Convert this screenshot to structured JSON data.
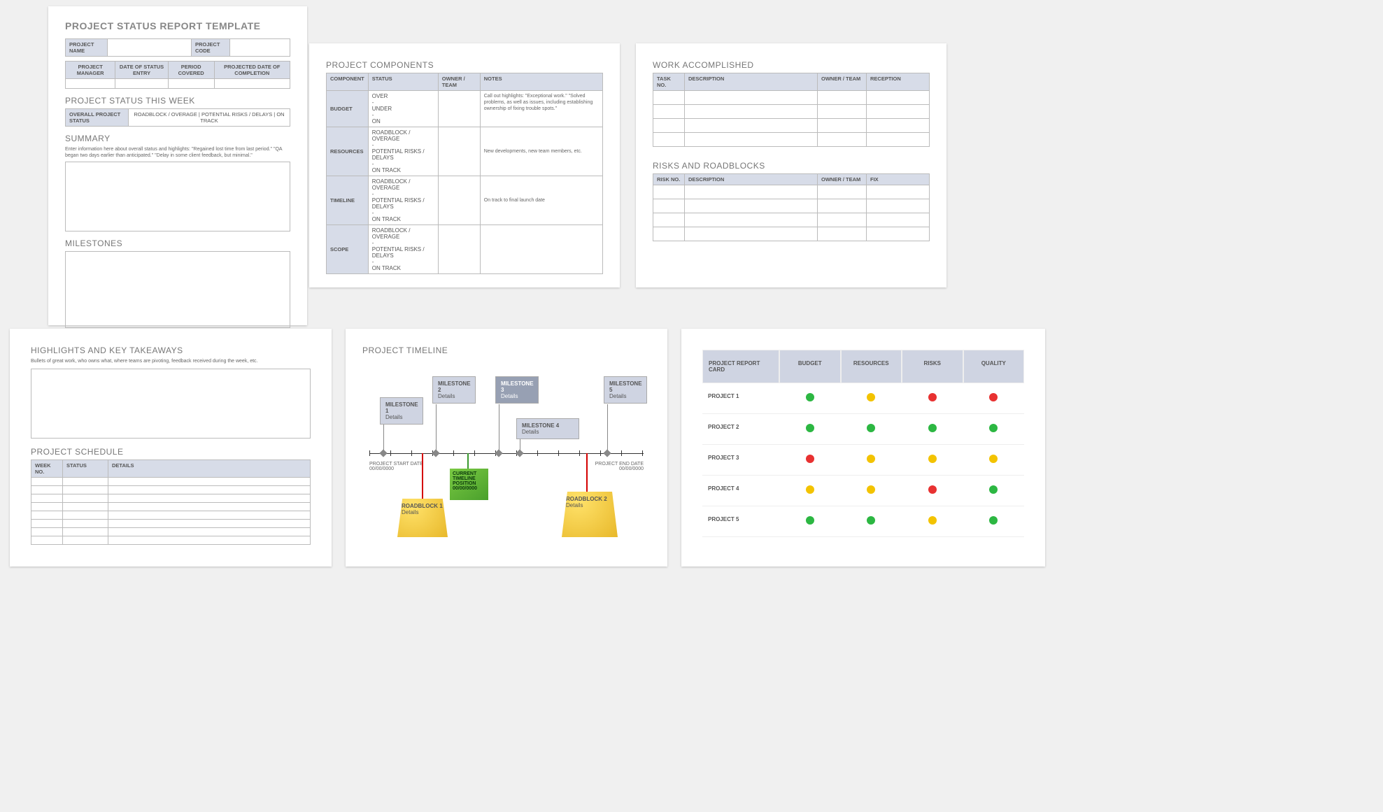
{
  "page1": {
    "title": "PROJECT STATUS REPORT TEMPLATE",
    "meta1": {
      "name_label": "PROJECT NAME",
      "code_label": "PROJECT CODE"
    },
    "meta2": {
      "pm": "PROJECT MANAGER",
      "date": "DATE OF STATUS ENTRY",
      "period": "PERIOD COVERED",
      "completion": "PROJECTED DATE OF COMPLETION"
    },
    "status_heading": "PROJECT STATUS THIS WEEK",
    "status_row": {
      "label": "OVERALL PROJECT STATUS",
      "opts": "ROADBLOCK / OVERAGE   |   POTENTIAL RISKS / DELAYS   |   ON TRACK"
    },
    "summary_heading": "SUMMARY",
    "summary_help": "Enter information here about overall status and highlights: \"Regained lost time from last period.\" \"QA began two days earlier than anticipated.\" \"Delay in some client feedback, but minimal.\"",
    "milestones_heading": "MILESTONES"
  },
  "page2": {
    "title": "PROJECT COMPONENTS",
    "headers": [
      "COMPONENT",
      "STATUS",
      "OWNER / TEAM",
      "NOTES"
    ],
    "rows": [
      {
        "comp": "BUDGET",
        "status": "OVER\n-\nUNDER\n-\nON",
        "notes": "Call out highlights: \"Exceptional work.\" \"Solved problems, as well as issues, including establishing ownership of fixing trouble spots.\""
      },
      {
        "comp": "RESOURCES",
        "status": "ROADBLOCK / OVERAGE\n-\nPOTENTIAL RISKS / DELAYS\n-\nON TRACK",
        "notes": "New developments, new team members, etc."
      },
      {
        "comp": "TIMELINE",
        "status": "ROADBLOCK / OVERAGE\n-\nPOTENTIAL RISKS / DELAYS\n-\nON TRACK",
        "notes": "On track to final launch date"
      },
      {
        "comp": "SCOPE",
        "status": "ROADBLOCK / OVERAGE\n-\nPOTENTIAL RISKS / DELAYS\n-\nON TRACK",
        "notes": ""
      }
    ]
  },
  "page3": {
    "work_title": "WORK ACCOMPLISHED",
    "work_headers": [
      "TASK NO.",
      "DESCRIPTION",
      "OWNER / TEAM",
      "RECEPTION"
    ],
    "risks_title": "RISKS AND ROADBLOCKS",
    "risks_headers": [
      "RISK NO.",
      "DESCRIPTION",
      "OWNER / TEAM",
      "FIX"
    ]
  },
  "page4": {
    "high_title": "HIGHLIGHTS AND KEY TAKEAWAYS",
    "high_help": "Bullets of great work, who owns what, where teams are pivoting, feedback received during the week, etc.",
    "sched_title": "PROJECT SCHEDULE",
    "sched_headers": [
      "WEEK NO.",
      "STATUS",
      "DETAILS"
    ]
  },
  "page5": {
    "title": "PROJECT TIMELINE",
    "start": {
      "label": "PROJECT START DATE",
      "date": "00/00/0000"
    },
    "end": {
      "label": "PROJECT END DATE",
      "date": "00/00/0000"
    },
    "milestones": [
      {
        "title": "MILESTONE 1",
        "sub": "Details"
      },
      {
        "title": "MILESTONE 2",
        "sub": "Details"
      },
      {
        "title": "MILESTONE 3",
        "sub": "Details"
      },
      {
        "title": "MILESTONE 4",
        "sub": "Details"
      },
      {
        "title": "MILESTONE 5",
        "sub": "Details"
      }
    ],
    "roadblocks": [
      {
        "title": "ROADBLOCK 1",
        "sub": "Details"
      },
      {
        "title": "ROADBLOCK 2",
        "sub": "Details"
      }
    ],
    "current": {
      "l1": "CURRENT",
      "l2": "TIMELINE",
      "l3": "POSITION",
      "l4": "00/00/0000"
    }
  },
  "page6": {
    "title": "PROJECT REPORT CARD",
    "cols": [
      "BUDGET",
      "RESOURCES",
      "RISKS",
      "QUALITY"
    ],
    "rows": [
      "PROJECT 1",
      "PROJECT 2",
      "PROJECT 3",
      "PROJECT 4",
      "PROJECT 5"
    ]
  },
  "chart_data": {
    "type": "table",
    "title": "PROJECT REPORT CARD",
    "columns": [
      "BUDGET",
      "RESOURCES",
      "RISKS",
      "QUALITY"
    ],
    "rows": [
      "PROJECT 1",
      "PROJECT 2",
      "PROJECT 3",
      "PROJECT 4",
      "PROJECT 5"
    ],
    "values": [
      [
        "green",
        "yellow",
        "red",
        "red"
      ],
      [
        "green",
        "green",
        "green",
        "green"
      ],
      [
        "red",
        "yellow",
        "yellow",
        "yellow"
      ],
      [
        "yellow",
        "yellow",
        "red",
        "green"
      ],
      [
        "green",
        "green",
        "yellow",
        "green"
      ]
    ]
  }
}
